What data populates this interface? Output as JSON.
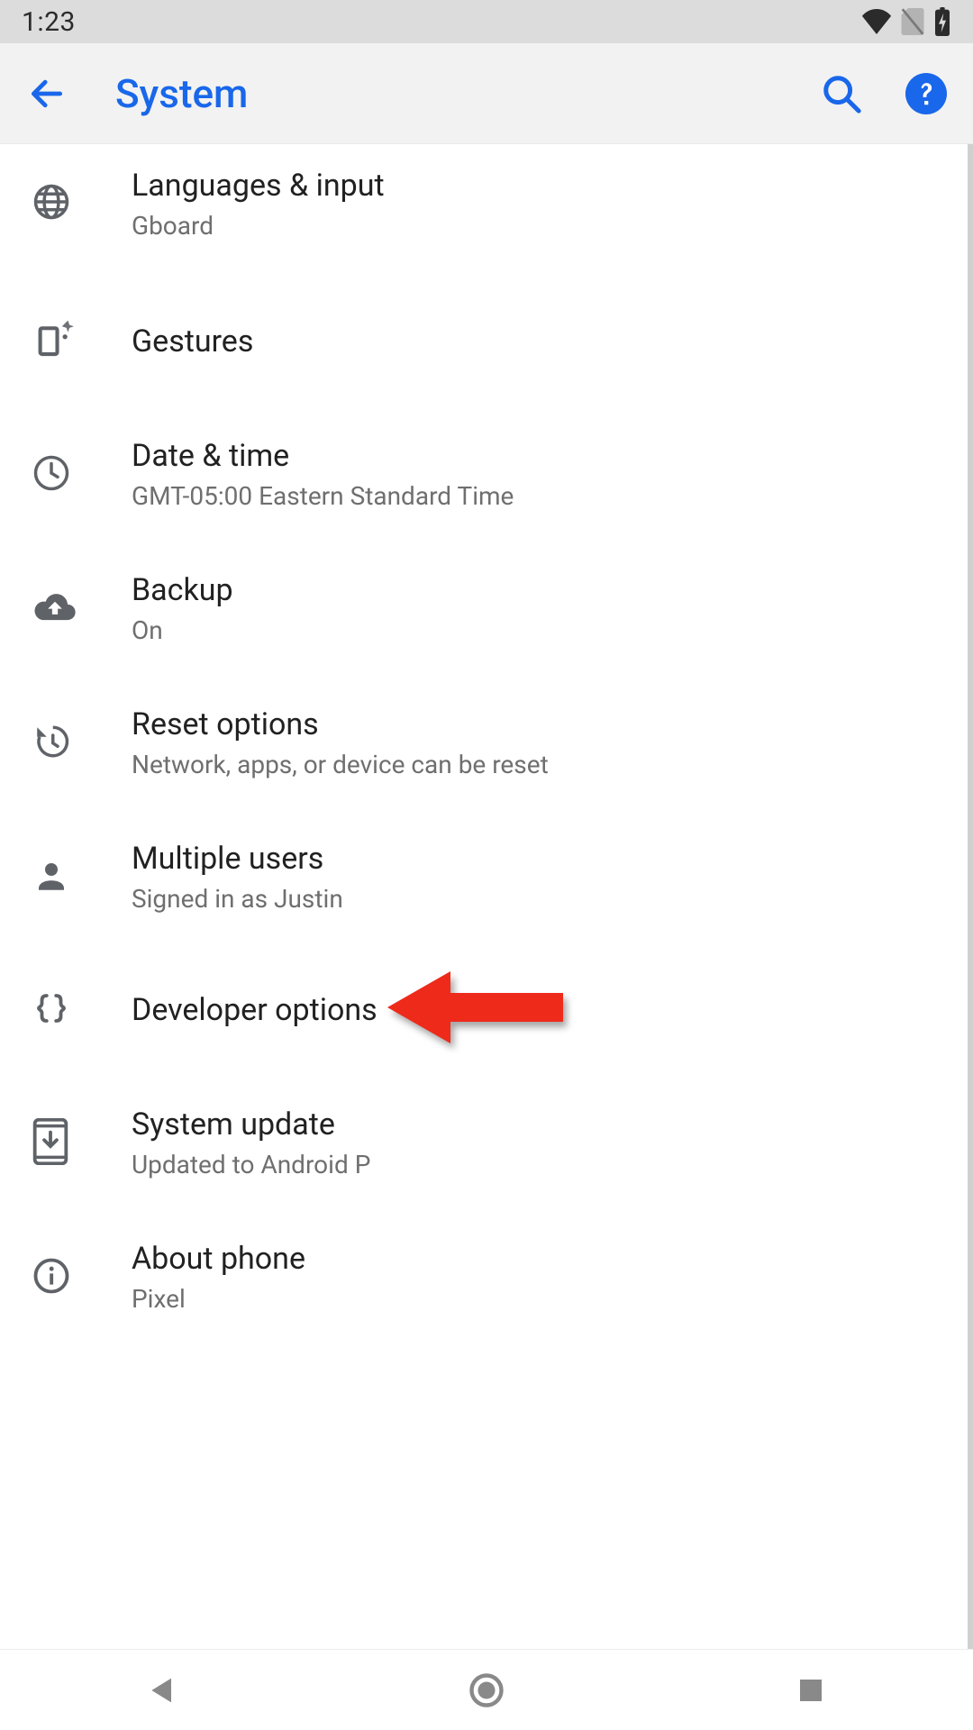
{
  "status": {
    "time": "1:23"
  },
  "appbar": {
    "title": "System"
  },
  "items": [
    {
      "title": "Languages & input",
      "sub": "Gboard"
    },
    {
      "title": "Gestures",
      "sub": ""
    },
    {
      "title": "Date & time",
      "sub": "GMT-05:00 Eastern Standard Time"
    },
    {
      "title": "Backup",
      "sub": "On"
    },
    {
      "title": "Reset options",
      "sub": "Network, apps, or device can be reset"
    },
    {
      "title": "Multiple users",
      "sub": "Signed in as Justin"
    },
    {
      "title": "Developer options",
      "sub": ""
    },
    {
      "title": "System update",
      "sub": "Updated to Android P"
    },
    {
      "title": "About phone",
      "sub": "Pixel"
    }
  ],
  "annotation": {
    "target_index": 6
  }
}
